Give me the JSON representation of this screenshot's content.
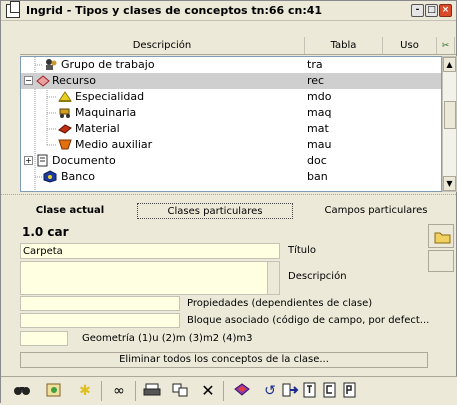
{
  "window": {
    "title": "Ingrid - Tipos y clases de conceptos tn:66 cn:41",
    "btn_min": "-",
    "btn_max": "□",
    "btn_close": "×"
  },
  "columns": {
    "description": "Descripción",
    "tabla": "Tabla",
    "uso": "Uso",
    "corner": "✂"
  },
  "tree": [
    {
      "label": "Grupo de trabajo",
      "tabla": "tra"
    },
    {
      "label": "Recurso",
      "tabla": "rec"
    },
    {
      "label": "Especialidad",
      "tabla": "mdo"
    },
    {
      "label": "Maquinaria",
      "tabla": "maq"
    },
    {
      "label": "Material",
      "tabla": "mat"
    },
    {
      "label": "Medio auxiliar",
      "tabla": "mau"
    },
    {
      "label": "Documento",
      "tabla": "doc"
    },
    {
      "label": "Banco",
      "tabla": "ban"
    }
  ],
  "tabs": {
    "current": "Clase actual",
    "particular": "Clases particulares",
    "fields": "Campos particulares"
  },
  "form": {
    "heading": "1.0 car",
    "title_value": "Carpeta",
    "title_label": "Título",
    "description_label": "Descripción",
    "properties_label": "Propiedades (dependientes de clase)",
    "block_label": "Bloque asociado (código de campo, por defect...",
    "geometry_label": "Geometría (1)u (2)m (3)m2 (4)m3",
    "delete_button": "Eliminar todos los conceptos de la clase..."
  },
  "toolbar": {
    "binoculars": "⚖",
    "chain": "∞",
    "print": "⎙",
    "delete": "✕",
    "refresh": "↺"
  }
}
